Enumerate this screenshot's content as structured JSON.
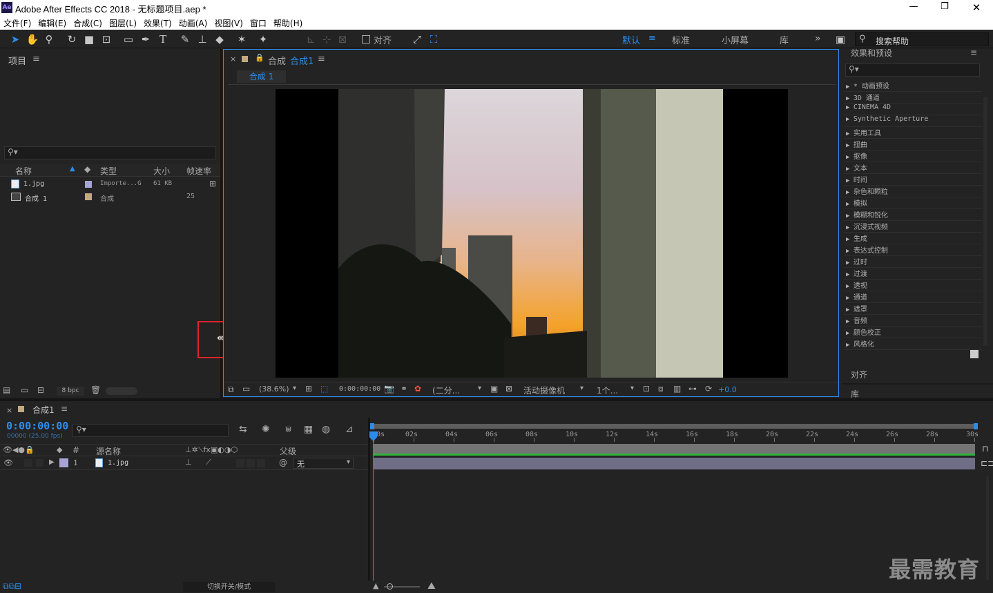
{
  "titlebar": {
    "app_icon": "Ae",
    "title": "Adobe After Effects CC 2018 - 无标题项目.aep *"
  },
  "menu": [
    "文件(F)",
    "编辑(E)",
    "合成(C)",
    "图层(L)",
    "效果(T)",
    "动画(A)",
    "视图(V)",
    "窗口",
    "帮助(H)"
  ],
  "toolbar": {
    "align_label": "对齐",
    "workspaces": [
      "默认",
      "标准",
      "小屏幕",
      "库"
    ],
    "active_workspace": "默认",
    "search_placeholder": "搜索帮助"
  },
  "project": {
    "title": "项目",
    "columns": [
      "名称",
      "类型",
      "大小",
      "帧速率"
    ],
    "items": [
      {
        "name": "1.jpg",
        "type": "Importe...G",
        "size": "61 KB",
        "fps": "",
        "label_color": "#a7a3d6"
      },
      {
        "name": "合成 1",
        "type": "合成",
        "size": "",
        "fps": "25",
        "label_color": "#c2aa7e"
      }
    ],
    "bpc": "8 bpc"
  },
  "composition": {
    "panel_label": "合成",
    "comp_name": "合成1",
    "tab": "合成 1",
    "zoom": "(38.6%)",
    "timecode": "0:00:00:00",
    "resolution": "(二分...",
    "camera": "活动摄像机",
    "views": "1个...",
    "exposure": "+0.0"
  },
  "effects": {
    "title": "效果和预设",
    "categories": [
      "* 动画预设",
      "3D 通道",
      "CINEMA 4D",
      "Synthetic Aperture",
      "实用工具",
      "扭曲",
      "抠像",
      "文本",
      "时间",
      "杂色和颗粒",
      "模拟",
      "模糊和锐化",
      "沉浸式视频",
      "生成",
      "表达式控制",
      "过时",
      "过渡",
      "透视",
      "通道",
      "遮罩",
      "音频",
      "颜色校正",
      "风格化"
    ],
    "align_title": "对齐",
    "lib_title": "库"
  },
  "timeline": {
    "tab": "合成1",
    "timecode": "0:00:00:00",
    "frames": "00000 (25.00 fps)",
    "columns": {
      "num": "#",
      "source": "源名称",
      "parent": "父级"
    },
    "layer": {
      "num": "1",
      "name": "1.jpg",
      "parent": "无",
      "label_color": "#a7a3d6"
    },
    "ticks": [
      "0s",
      "02s",
      "04s",
      "06s",
      "08s",
      "10s",
      "12s",
      "14s",
      "16s",
      "18s",
      "20s",
      "22s",
      "24s",
      "26s",
      "28s",
      "30s"
    ],
    "footer": "切换开关/模式"
  },
  "watermark": "最需教育",
  "colors": {
    "accent": "#2d8ceb",
    "highlight_box": "#e0242a",
    "green_bar": "#2fb33b",
    "layer_bar": "#6f6e86"
  }
}
